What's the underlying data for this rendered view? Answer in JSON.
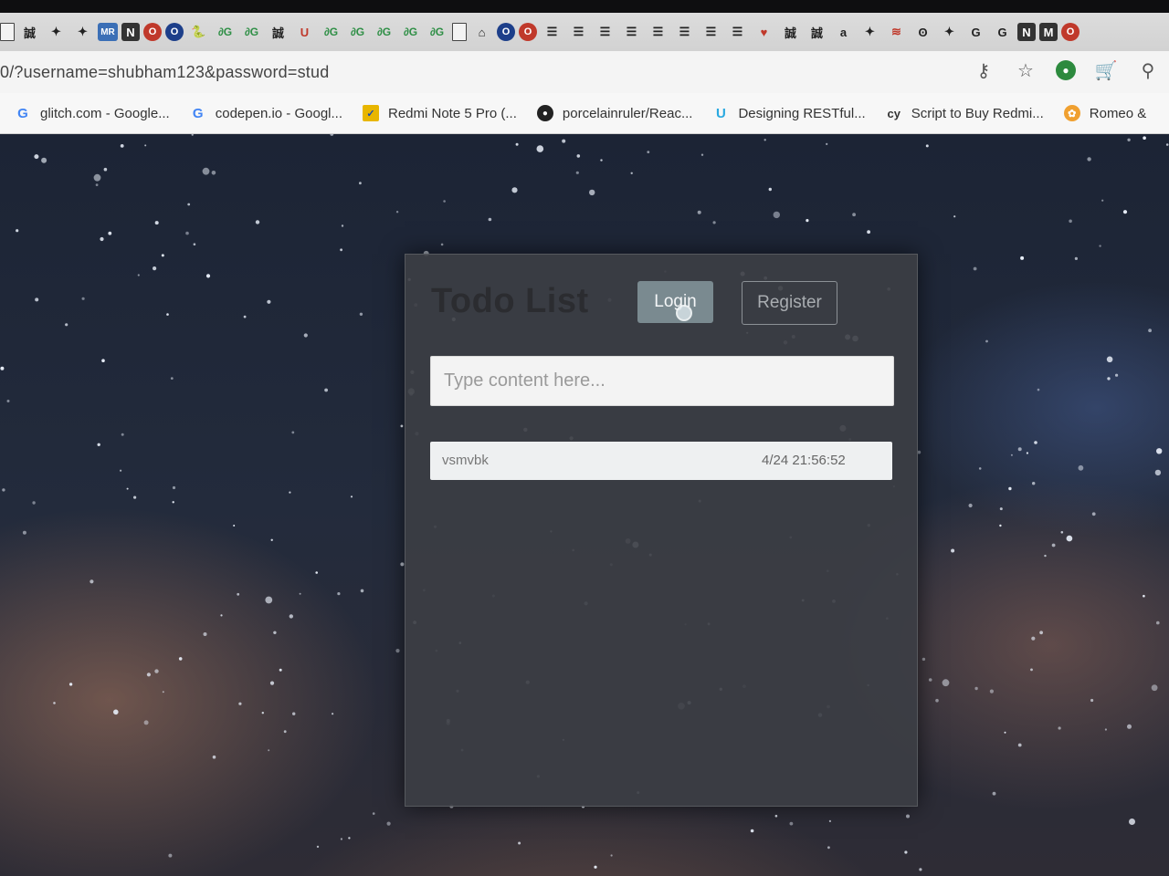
{
  "browser": {
    "url": "0/?username=shubham123&password=stud",
    "extensions": [
      {
        "icon": "page-icon",
        "glyph": ""
      },
      {
        "icon": "kanji-icon",
        "glyph": "誠"
      },
      {
        "icon": "figure-icon",
        "glyph": "✦"
      },
      {
        "icon": "figure-icon",
        "glyph": "✦"
      },
      {
        "icon": "mr-icon",
        "glyph": "MR"
      },
      {
        "icon": "notion-icon",
        "glyph": "N"
      },
      {
        "icon": "opera-icon",
        "glyph": "O"
      },
      {
        "icon": "o-icon",
        "glyph": "O"
      },
      {
        "icon": "python-icon",
        "glyph": "🐍"
      },
      {
        "icon": "gfg-icon",
        "glyph": "∂G"
      },
      {
        "icon": "gfg-icon",
        "glyph": "∂G"
      },
      {
        "icon": "kanji-icon",
        "glyph": "誠"
      },
      {
        "icon": "u-icon",
        "glyph": "U"
      },
      {
        "icon": "gfg-icon",
        "glyph": "∂G"
      },
      {
        "icon": "gfg-icon",
        "glyph": "∂G"
      },
      {
        "icon": "gfg-icon",
        "glyph": "∂G"
      },
      {
        "icon": "gfg-icon",
        "glyph": "∂G"
      },
      {
        "icon": "gfg-icon",
        "glyph": "∂G"
      },
      {
        "icon": "page-icon",
        "glyph": ""
      },
      {
        "icon": "home-icon",
        "glyph": "⌂"
      },
      {
        "icon": "o-icon",
        "glyph": "O"
      },
      {
        "icon": "opera-icon",
        "glyph": "O"
      },
      {
        "icon": "list-icon",
        "glyph": "☰"
      },
      {
        "icon": "list-icon",
        "glyph": "☰"
      },
      {
        "icon": "list-icon",
        "glyph": "☰"
      },
      {
        "icon": "list-icon",
        "glyph": "☰"
      },
      {
        "icon": "list-icon",
        "glyph": "☰"
      },
      {
        "icon": "list-icon",
        "glyph": "☰"
      },
      {
        "icon": "list-icon",
        "glyph": "☰"
      },
      {
        "icon": "list-icon",
        "glyph": "☰"
      },
      {
        "icon": "pocket-icon",
        "glyph": "♥"
      },
      {
        "icon": "kanji-icon",
        "glyph": "誠"
      },
      {
        "icon": "kanji-icon",
        "glyph": "誠"
      },
      {
        "icon": "amazon-icon",
        "glyph": "a"
      },
      {
        "icon": "figure-icon",
        "glyph": "✦"
      },
      {
        "icon": "lines-icon",
        "glyph": "≋"
      },
      {
        "icon": "bunny-icon",
        "glyph": "ʘ"
      },
      {
        "icon": "figure-icon",
        "glyph": "✦"
      },
      {
        "icon": "google-icon",
        "glyph": "G"
      },
      {
        "icon": "google-icon",
        "glyph": "G"
      },
      {
        "icon": "notion-icon",
        "glyph": "N"
      },
      {
        "icon": "medium-icon",
        "glyph": "M"
      },
      {
        "icon": "opera-icon",
        "glyph": "O"
      }
    ],
    "bookmarks": [
      {
        "label": "glitch.com - Google...",
        "icon": "google-icon",
        "glyph": "G"
      },
      {
        "label": "codepen.io - Googl...",
        "icon": "google-icon",
        "glyph": "G"
      },
      {
        "label": "Redmi Note 5 Pro (...",
        "icon": "redmi-icon",
        "glyph": "✓"
      },
      {
        "label": "porcelainruler/Reac...",
        "icon": "github-icon",
        "glyph": "●"
      },
      {
        "label": "Designing RESTful...",
        "icon": "udemy-icon",
        "glyph": "U"
      },
      {
        "label": "Script to Buy Redmi...",
        "icon": "cy-icon",
        "glyph": "cy"
      },
      {
        "label": "Romeo &",
        "icon": "romeo-icon",
        "glyph": "✿"
      }
    ]
  },
  "app": {
    "title": "Todo List",
    "login_label": "Login",
    "register_label": "Register",
    "input_placeholder": "Type content here...",
    "input_value": "",
    "todos": [
      {
        "text": "vsmvbk",
        "time": "4/24 21:56:52"
      }
    ]
  }
}
